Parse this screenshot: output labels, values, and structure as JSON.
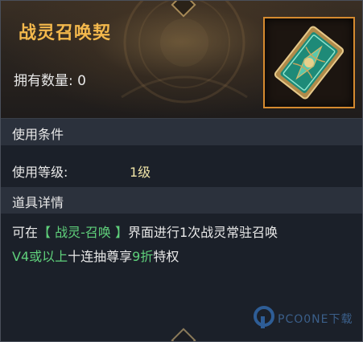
{
  "item": {
    "title": "战灵召唤契",
    "owned_label": "拥有数量:",
    "owned_count": "0",
    "icon": "jade-card-icon"
  },
  "conditions": {
    "header": "使用条件",
    "level_label": "使用等级:",
    "level_value": "1级"
  },
  "details": {
    "header": "道具详情",
    "seg1": "可在",
    "seg2": "【 战灵-召唤 】",
    "seg3": "界面进行1次战灵常驻召唤",
    "seg4": "V4或以上",
    "seg5": "十连抽尊享",
    "seg6": "9折",
    "seg7": "特权"
  },
  "watermark": {
    "text": "PCO0NE下载"
  },
  "colors": {
    "title": "#f3b84c",
    "highlight": "#5fd07b",
    "frame": "#d58a2f"
  }
}
